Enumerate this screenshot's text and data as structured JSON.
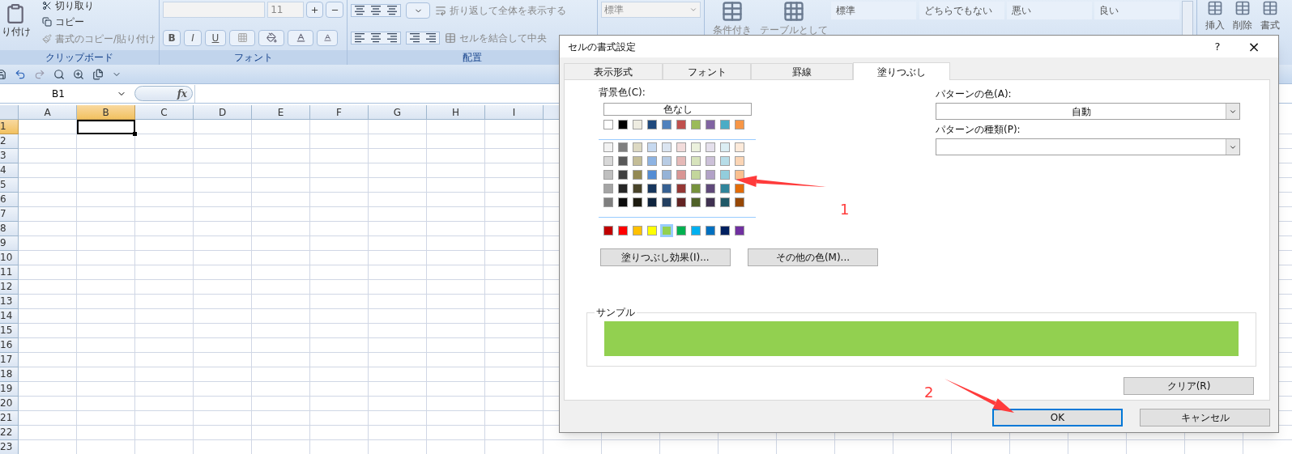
{
  "ribbon": {
    "clipboard": {
      "paste": "り付け",
      "cut": "切り取り",
      "copy": "コピー",
      "format_painter": "書式のコピー/貼り付け",
      "label": "クリップボード"
    },
    "font": {
      "size": "11",
      "bold": "B",
      "italic": "I",
      "underline": "U",
      "label": "フォント"
    },
    "alignment": {
      "wrap_text": "折り返して全体を表示する",
      "merge_center": "セルを結合して中央",
      "label": "配置"
    },
    "number": {
      "format": "標準"
    },
    "styles": {
      "conditional": "条件付き",
      "table": "テーブルとして",
      "gallery": [
        "標準",
        "どちらでもない",
        "悪い",
        "良い"
      ]
    },
    "cells": {
      "insert": "挿入",
      "delete": "削除",
      "format": "書式"
    }
  },
  "formula_bar": {
    "name_box": "B1",
    "function_label": "fx"
  },
  "sheet": {
    "columns": [
      {
        "label": "A",
        "selected": false
      },
      {
        "label": "B",
        "selected": true
      },
      {
        "label": "C",
        "selected": false
      },
      {
        "label": "D",
        "selected": false
      },
      {
        "label": "E",
        "selected": false
      },
      {
        "label": "F",
        "selected": false
      },
      {
        "label": "G",
        "selected": false
      },
      {
        "label": "H",
        "selected": false
      },
      {
        "label": "I",
        "selected": false
      }
    ],
    "rows": [
      {
        "label": "1",
        "selected": true
      },
      {
        "label": "2",
        "selected": false
      },
      {
        "label": "3",
        "selected": false
      },
      {
        "label": "4",
        "selected": false
      },
      {
        "label": "5",
        "selected": false
      },
      {
        "label": "6",
        "selected": false
      },
      {
        "label": "7",
        "selected": false
      },
      {
        "label": "8",
        "selected": false
      },
      {
        "label": "9",
        "selected": false
      },
      {
        "label": "10",
        "selected": false
      },
      {
        "label": "11",
        "selected": false
      },
      {
        "label": "12",
        "selected": false
      },
      {
        "label": "13",
        "selected": false
      },
      {
        "label": "14",
        "selected": false
      },
      {
        "label": "15",
        "selected": false
      },
      {
        "label": "16",
        "selected": false
      },
      {
        "label": "17",
        "selected": false
      },
      {
        "label": "18",
        "selected": false
      },
      {
        "label": "19",
        "selected": false
      },
      {
        "label": "20",
        "selected": false
      },
      {
        "label": "21",
        "selected": false
      },
      {
        "label": "22",
        "selected": false
      },
      {
        "label": "23",
        "selected": false
      }
    ]
  },
  "dialog": {
    "title": "セルの書式設定",
    "help": "?",
    "close": "×",
    "tabs": [
      {
        "label": "表示形式",
        "selected": false
      },
      {
        "label": "フォント",
        "selected": false
      },
      {
        "label": "罫線",
        "selected": false
      },
      {
        "label": "塗りつぶし",
        "selected": true
      }
    ],
    "background_label": "背景色(C):",
    "no_color_button": "色なし",
    "palette": {
      "theme": [
        {
          "color": "#ffffff",
          "selected": false
        },
        {
          "color": "#000000",
          "selected": false
        },
        {
          "color": "#eeece1",
          "selected": false
        },
        {
          "color": "#1f497d",
          "selected": false
        },
        {
          "color": "#4f81bd",
          "selected": false
        },
        {
          "color": "#c0504d",
          "selected": false
        },
        {
          "color": "#9bbb59",
          "selected": false
        },
        {
          "color": "#8064a2",
          "selected": false
        },
        {
          "color": "#4bacc6",
          "selected": false
        },
        {
          "color": "#f79646",
          "selected": false
        }
      ],
      "tints": [
        [
          {
            "color": "#f2f2f2",
            "selected": false
          },
          {
            "color": "#7f7f7f",
            "selected": false
          },
          {
            "color": "#ddd9c3",
            "selected": false
          },
          {
            "color": "#c6d9f0",
            "selected": false
          },
          {
            "color": "#dbe5f1",
            "selected": false
          },
          {
            "color": "#f2dcdb",
            "selected": false
          },
          {
            "color": "#ebf1dd",
            "selected": false
          },
          {
            "color": "#e5e0ec",
            "selected": false
          },
          {
            "color": "#dbeef3",
            "selected": false
          },
          {
            "color": "#fdeada",
            "selected": false
          }
        ],
        [
          {
            "color": "#d8d8d8",
            "selected": false
          },
          {
            "color": "#595959",
            "selected": false
          },
          {
            "color": "#c4bd97",
            "selected": false
          },
          {
            "color": "#8db3e2",
            "selected": false
          },
          {
            "color": "#b8cce4",
            "selected": false
          },
          {
            "color": "#e5b9b7",
            "selected": false
          },
          {
            "color": "#d7e3bc",
            "selected": false
          },
          {
            "color": "#ccc1d9",
            "selected": false
          },
          {
            "color": "#b7dde8",
            "selected": false
          },
          {
            "color": "#fbd5b5",
            "selected": false
          }
        ],
        [
          {
            "color": "#bfbfbf",
            "selected": false
          },
          {
            "color": "#3f3f3f",
            "selected": false
          },
          {
            "color": "#938953",
            "selected": false
          },
          {
            "color": "#548dd4",
            "selected": false
          },
          {
            "color": "#95b3d7",
            "selected": false
          },
          {
            "color": "#d99694",
            "selected": false
          },
          {
            "color": "#c3d69b",
            "selected": false
          },
          {
            "color": "#b2a2c7",
            "selected": false
          },
          {
            "color": "#92cddc",
            "selected": false
          },
          {
            "color": "#fac08f",
            "selected": false
          }
        ],
        [
          {
            "color": "#a5a5a5",
            "selected": false
          },
          {
            "color": "#262626",
            "selected": false
          },
          {
            "color": "#494429",
            "selected": false
          },
          {
            "color": "#17365d",
            "selected": false
          },
          {
            "color": "#366092",
            "selected": false
          },
          {
            "color": "#953734",
            "selected": false
          },
          {
            "color": "#76923c",
            "selected": false
          },
          {
            "color": "#5f497a",
            "selected": false
          },
          {
            "color": "#31859b",
            "selected": false
          },
          {
            "color": "#e36c09",
            "selected": false
          }
        ],
        [
          {
            "color": "#7f7f7f",
            "selected": false
          },
          {
            "color": "#0c0c0c",
            "selected": false
          },
          {
            "color": "#1d1b10",
            "selected": false
          },
          {
            "color": "#0f243e",
            "selected": false
          },
          {
            "color": "#244061",
            "selected": false
          },
          {
            "color": "#632423",
            "selected": false
          },
          {
            "color": "#4f6128",
            "selected": false
          },
          {
            "color": "#3f3151",
            "selected": false
          },
          {
            "color": "#205867",
            "selected": false
          },
          {
            "color": "#974806",
            "selected": false
          }
        ]
      ],
      "standard": [
        {
          "color": "#c00000",
          "selected": false
        },
        {
          "color": "#ff0000",
          "selected": false
        },
        {
          "color": "#ffc000",
          "selected": false
        },
        {
          "color": "#ffff00",
          "selected": false
        },
        {
          "color": "#92d050",
          "selected": true
        },
        {
          "color": "#00b050",
          "selected": false
        },
        {
          "color": "#00b0f0",
          "selected": false
        },
        {
          "color": "#0070c0",
          "selected": false
        },
        {
          "color": "#002060",
          "selected": false
        },
        {
          "color": "#7030a0",
          "selected": false
        }
      ]
    },
    "fill_effects_button": "塗りつぶし効果(I)...",
    "more_colors_button": "その他の色(M)...",
    "pattern_color_label": "パターンの色(A):",
    "pattern_color_value": "自動",
    "pattern_style_label": "パターンの種類(P):",
    "sample_label": "サンプル",
    "clear_button": "クリア(R)",
    "ok_button": {
      "label": "OK",
      "focused": true
    },
    "cancel_button": "キャンセル"
  },
  "annotations": [
    {
      "label": "1"
    },
    {
      "label": "2"
    }
  ]
}
